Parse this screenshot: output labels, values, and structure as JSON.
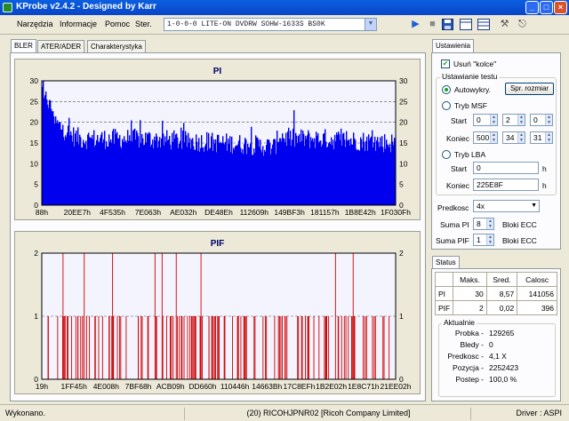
{
  "window": {
    "title": "KProbe v2.4.2 - Designed by Karr"
  },
  "menu": [
    "Narzędzia",
    "Informacje",
    "Pomoc",
    "Ster."
  ],
  "drive": {
    "selected": "1-0-0-0 LITE-ON DVDRW SOHW-1633S BS0K"
  },
  "toolbar": {
    "icons": [
      "play-icon",
      "stop-icon",
      "save-icon",
      "layout-one-icon",
      "layout-two-icon",
      "tools-icon",
      "exit-icon"
    ]
  },
  "tabs": [
    "BLER",
    "ATER/ADER",
    "Charakterystyka"
  ],
  "chart_data": [
    {
      "type": "bar",
      "title": "PI",
      "ylim": [
        0,
        30
      ],
      "yticks": [
        0,
        5,
        10,
        15,
        20,
        25,
        30
      ],
      "xticks": [
        "88h",
        "20EE7h",
        "4F535h",
        "7E063h",
        "AE032h",
        "DE48Eh",
        "112609h",
        "149BF3h",
        "181157h",
        "1B8E42h",
        "1F030Fh"
      ],
      "grid": true,
      "color": "#0000EE",
      "profile": [
        [
          0,
          24
        ],
        [
          0.02,
          21
        ],
        [
          0.05,
          19
        ],
        [
          0.08,
          17
        ],
        [
          0.11,
          16
        ],
        [
          0.2,
          16
        ],
        [
          0.3,
          16
        ],
        [
          0.4,
          15.5
        ],
        [
          0.52,
          15
        ],
        [
          0.6,
          14.5
        ],
        [
          0.66,
          14
        ],
        [
          0.67,
          17
        ],
        [
          0.7,
          16
        ],
        [
          0.8,
          16
        ],
        [
          0.9,
          15.5
        ],
        [
          1,
          15
        ]
      ]
    },
    {
      "type": "bar",
      "title": "PIF",
      "ylim": [
        0,
        2
      ],
      "yticks": [
        0,
        1,
        2
      ],
      "xticks": [
        "19h",
        "1FF45h",
        "4E008h",
        "7BF68h",
        "ACB09h",
        "DD660h",
        "110446h",
        "14663Bh",
        "17C8EFh",
        "1B2E02h",
        "1E8C71h",
        "21EE02h"
      ],
      "grid": true,
      "color": "#CC0000",
      "spikes2": [
        0.06,
        0.12,
        0.2,
        0.32,
        0.34,
        0.38,
        0.45,
        0.83,
        0.88
      ]
    }
  ],
  "settings": {
    "tab": "Ustawienia",
    "usun_kolce": "Usuń \"kolce\"",
    "test_group": "Ustawianie testu",
    "autowykry": "Autowykry.",
    "spr_rozmiar": "Spr. rozmiar",
    "tryb_msf": "Tryb MSF",
    "start": "Start",
    "koniec": "Koniec",
    "msf_start": [
      "0",
      "2",
      "0"
    ],
    "msf_end": [
      "500",
      "34",
      "31"
    ],
    "tryb_lba": "Tryb LBA",
    "lba_start": "0",
    "lba_end": "225E8F",
    "unit_h": "h",
    "predkosc_label": "Predkosc",
    "predkosc_value": "4x",
    "suma_pi_label": "Suma PI",
    "suma_pi_value": "8",
    "suma_pif_label": "Suma PIF",
    "suma_pif_value": "1",
    "bloki": "Bloki ECC"
  },
  "status": {
    "tab": "Status",
    "headers": [
      "Maks.",
      "Sred.",
      "Calosc"
    ],
    "rows": [
      {
        "label": "PI",
        "max": "30",
        "avg": "8,57",
        "total": "141056"
      },
      {
        "label": "PIF",
        "max": "2",
        "avg": "0,02",
        "total": "396"
      }
    ],
    "aktualnie": "Aktualnie",
    "probka_label": "Probka -",
    "probka": "129265",
    "bledy_label": "Bledy -",
    "bledy": "0",
    "predkosc_label": "Predkosc -",
    "predkosc": "4,1 X",
    "pozycja_label": "Pozycja -",
    "pozycja": "2252423",
    "postep_label": "Postep -",
    "postep": "100,0 %"
  },
  "statusbar": {
    "left": "Wykonano.",
    "center": "(20) RICOHJPNR02 [Ricoh Company Limited]",
    "right": "Driver : ASPI"
  }
}
